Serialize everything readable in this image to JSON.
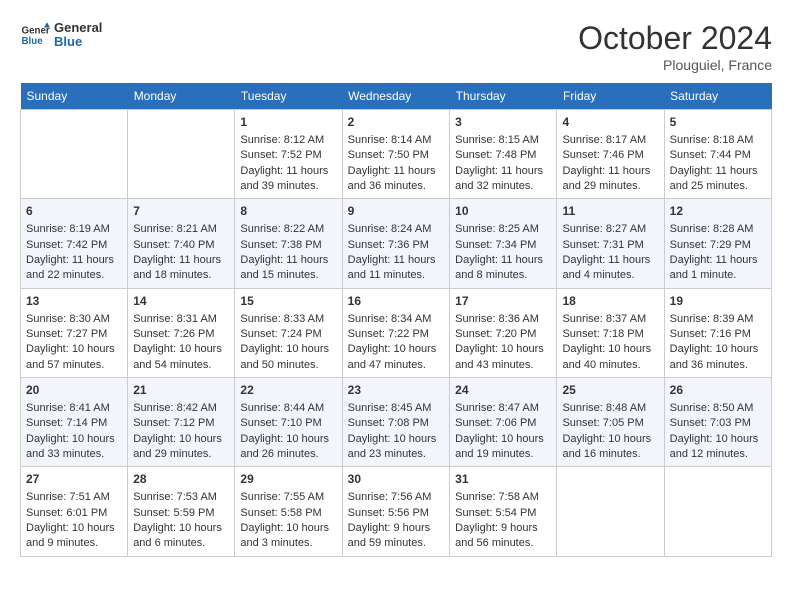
{
  "header": {
    "logo_general": "General",
    "logo_blue": "Blue",
    "month_title": "October 2024",
    "location": "Plouguiel, France"
  },
  "days_of_week": [
    "Sunday",
    "Monday",
    "Tuesday",
    "Wednesday",
    "Thursday",
    "Friday",
    "Saturday"
  ],
  "weeks": [
    [
      {
        "day": "",
        "sunrise": "",
        "sunset": "",
        "daylight": ""
      },
      {
        "day": "",
        "sunrise": "",
        "sunset": "",
        "daylight": ""
      },
      {
        "day": "1",
        "sunrise": "Sunrise: 8:12 AM",
        "sunset": "Sunset: 7:52 PM",
        "daylight": "Daylight: 11 hours and 39 minutes."
      },
      {
        "day": "2",
        "sunrise": "Sunrise: 8:14 AM",
        "sunset": "Sunset: 7:50 PM",
        "daylight": "Daylight: 11 hours and 36 minutes."
      },
      {
        "day": "3",
        "sunrise": "Sunrise: 8:15 AM",
        "sunset": "Sunset: 7:48 PM",
        "daylight": "Daylight: 11 hours and 32 minutes."
      },
      {
        "day": "4",
        "sunrise": "Sunrise: 8:17 AM",
        "sunset": "Sunset: 7:46 PM",
        "daylight": "Daylight: 11 hours and 29 minutes."
      },
      {
        "day": "5",
        "sunrise": "Sunrise: 8:18 AM",
        "sunset": "Sunset: 7:44 PM",
        "daylight": "Daylight: 11 hours and 25 minutes."
      }
    ],
    [
      {
        "day": "6",
        "sunrise": "Sunrise: 8:19 AM",
        "sunset": "Sunset: 7:42 PM",
        "daylight": "Daylight: 11 hours and 22 minutes."
      },
      {
        "day": "7",
        "sunrise": "Sunrise: 8:21 AM",
        "sunset": "Sunset: 7:40 PM",
        "daylight": "Daylight: 11 hours and 18 minutes."
      },
      {
        "day": "8",
        "sunrise": "Sunrise: 8:22 AM",
        "sunset": "Sunset: 7:38 PM",
        "daylight": "Daylight: 11 hours and 15 minutes."
      },
      {
        "day": "9",
        "sunrise": "Sunrise: 8:24 AM",
        "sunset": "Sunset: 7:36 PM",
        "daylight": "Daylight: 11 hours and 11 minutes."
      },
      {
        "day": "10",
        "sunrise": "Sunrise: 8:25 AM",
        "sunset": "Sunset: 7:34 PM",
        "daylight": "Daylight: 11 hours and 8 minutes."
      },
      {
        "day": "11",
        "sunrise": "Sunrise: 8:27 AM",
        "sunset": "Sunset: 7:31 PM",
        "daylight": "Daylight: 11 hours and 4 minutes."
      },
      {
        "day": "12",
        "sunrise": "Sunrise: 8:28 AM",
        "sunset": "Sunset: 7:29 PM",
        "daylight": "Daylight: 11 hours and 1 minute."
      }
    ],
    [
      {
        "day": "13",
        "sunrise": "Sunrise: 8:30 AM",
        "sunset": "Sunset: 7:27 PM",
        "daylight": "Daylight: 10 hours and 57 minutes."
      },
      {
        "day": "14",
        "sunrise": "Sunrise: 8:31 AM",
        "sunset": "Sunset: 7:26 PM",
        "daylight": "Daylight: 10 hours and 54 minutes."
      },
      {
        "day": "15",
        "sunrise": "Sunrise: 8:33 AM",
        "sunset": "Sunset: 7:24 PM",
        "daylight": "Daylight: 10 hours and 50 minutes."
      },
      {
        "day": "16",
        "sunrise": "Sunrise: 8:34 AM",
        "sunset": "Sunset: 7:22 PM",
        "daylight": "Daylight: 10 hours and 47 minutes."
      },
      {
        "day": "17",
        "sunrise": "Sunrise: 8:36 AM",
        "sunset": "Sunset: 7:20 PM",
        "daylight": "Daylight: 10 hours and 43 minutes."
      },
      {
        "day": "18",
        "sunrise": "Sunrise: 8:37 AM",
        "sunset": "Sunset: 7:18 PM",
        "daylight": "Daylight: 10 hours and 40 minutes."
      },
      {
        "day": "19",
        "sunrise": "Sunrise: 8:39 AM",
        "sunset": "Sunset: 7:16 PM",
        "daylight": "Daylight: 10 hours and 36 minutes."
      }
    ],
    [
      {
        "day": "20",
        "sunrise": "Sunrise: 8:41 AM",
        "sunset": "Sunset: 7:14 PM",
        "daylight": "Daylight: 10 hours and 33 minutes."
      },
      {
        "day": "21",
        "sunrise": "Sunrise: 8:42 AM",
        "sunset": "Sunset: 7:12 PM",
        "daylight": "Daylight: 10 hours and 29 minutes."
      },
      {
        "day": "22",
        "sunrise": "Sunrise: 8:44 AM",
        "sunset": "Sunset: 7:10 PM",
        "daylight": "Daylight: 10 hours and 26 minutes."
      },
      {
        "day": "23",
        "sunrise": "Sunrise: 8:45 AM",
        "sunset": "Sunset: 7:08 PM",
        "daylight": "Daylight: 10 hours and 23 minutes."
      },
      {
        "day": "24",
        "sunrise": "Sunrise: 8:47 AM",
        "sunset": "Sunset: 7:06 PM",
        "daylight": "Daylight: 10 hours and 19 minutes."
      },
      {
        "day": "25",
        "sunrise": "Sunrise: 8:48 AM",
        "sunset": "Sunset: 7:05 PM",
        "daylight": "Daylight: 10 hours and 16 minutes."
      },
      {
        "day": "26",
        "sunrise": "Sunrise: 8:50 AM",
        "sunset": "Sunset: 7:03 PM",
        "daylight": "Daylight: 10 hours and 12 minutes."
      }
    ],
    [
      {
        "day": "27",
        "sunrise": "Sunrise: 7:51 AM",
        "sunset": "Sunset: 6:01 PM",
        "daylight": "Daylight: 10 hours and 9 minutes."
      },
      {
        "day": "28",
        "sunrise": "Sunrise: 7:53 AM",
        "sunset": "Sunset: 5:59 PM",
        "daylight": "Daylight: 10 hours and 6 minutes."
      },
      {
        "day": "29",
        "sunrise": "Sunrise: 7:55 AM",
        "sunset": "Sunset: 5:58 PM",
        "daylight": "Daylight: 10 hours and 3 minutes."
      },
      {
        "day": "30",
        "sunrise": "Sunrise: 7:56 AM",
        "sunset": "Sunset: 5:56 PM",
        "daylight": "Daylight: 9 hours and 59 minutes."
      },
      {
        "day": "31",
        "sunrise": "Sunrise: 7:58 AM",
        "sunset": "Sunset: 5:54 PM",
        "daylight": "Daylight: 9 hours and 56 minutes."
      },
      {
        "day": "",
        "sunrise": "",
        "sunset": "",
        "daylight": ""
      },
      {
        "day": "",
        "sunrise": "",
        "sunset": "",
        "daylight": ""
      }
    ]
  ]
}
